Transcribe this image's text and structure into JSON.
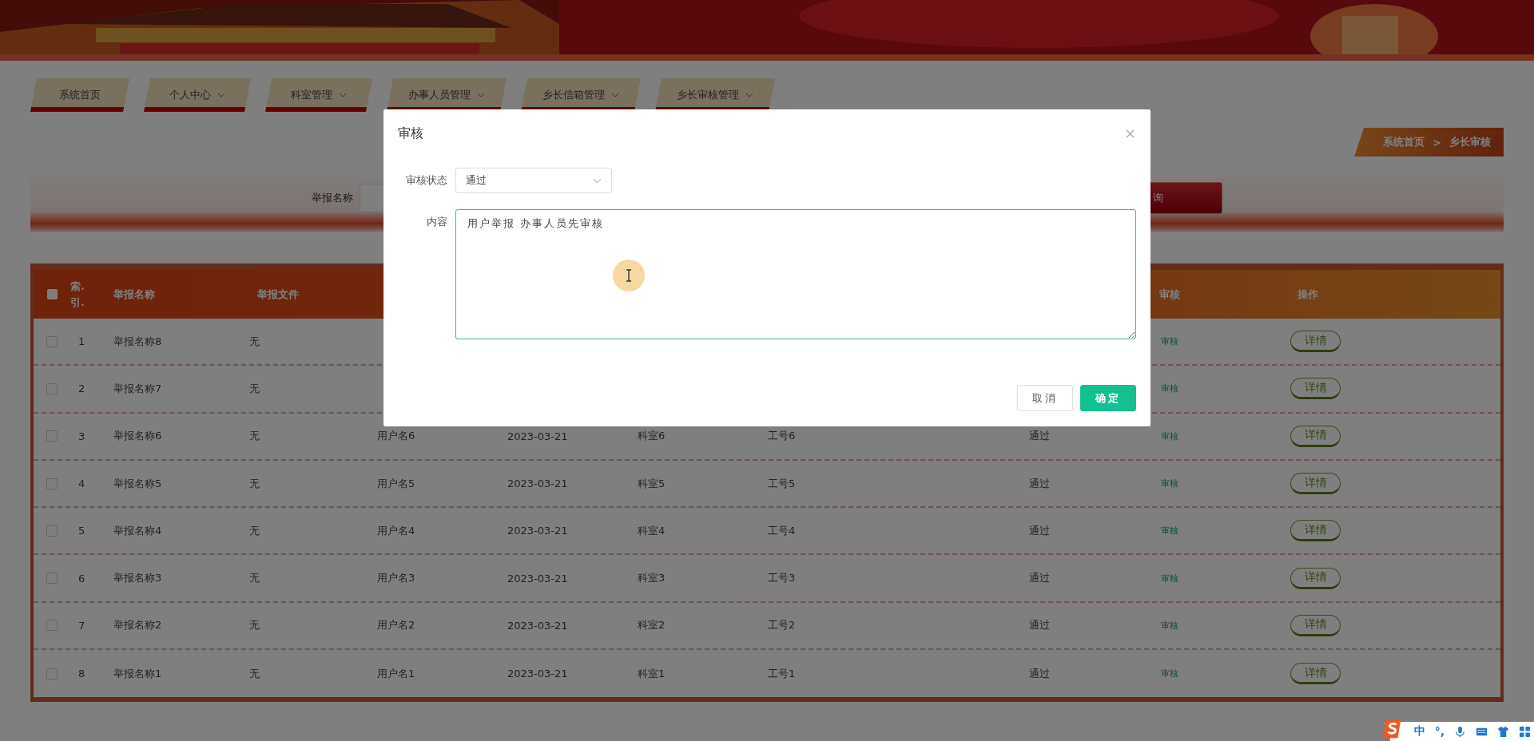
{
  "nav": [
    {
      "label": "系统首页",
      "has_menu": false
    },
    {
      "label": "个人中心",
      "has_menu": true
    },
    {
      "label": "科室管理",
      "has_menu": true
    },
    {
      "label": "办事人员管理",
      "has_menu": true
    },
    {
      "label": "乡长信箱管理",
      "has_menu": true
    },
    {
      "label": "乡长审核管理",
      "has_menu": true
    }
  ],
  "breadcrumb": [
    "系统首页",
    ">",
    "乡长审核"
  ],
  "search": {
    "label": "举报名称",
    "button": "询"
  },
  "table": {
    "select_all": {
      "checked": false
    },
    "columns": [
      {
        "label": "索.引."
      },
      {
        "label": "举报名称"
      },
      {
        "label": "举报文件"
      },
      {
        "label": "审核"
      },
      {
        "label": "操作"
      }
    ],
    "rows": [
      {
        "checked": false,
        "index": "1",
        "name": "举报名称8",
        "file": "无",
        "audit": "审核",
        "op": "详情"
      },
      {
        "checked": false,
        "index": "2",
        "name": "举报名称7",
        "file": "无",
        "audit": "审核",
        "op": "详情"
      },
      {
        "checked": false,
        "index": "3",
        "name": "举报名称6",
        "file": "无",
        "user": "用户名6",
        "date": "2023-03-21",
        "dept": "科室6",
        "staff": "工号6",
        "status": "通过",
        "audit": "审核",
        "op": "详情"
      },
      {
        "checked": false,
        "index": "4",
        "name": "举报名称5",
        "file": "无",
        "user": "用户名5",
        "date": "2023-03-21",
        "dept": "科室5",
        "staff": "工号5",
        "status": "通过",
        "audit": "审核",
        "op": "详情"
      },
      {
        "checked": false,
        "index": "5",
        "name": "举报名称4",
        "file": "无",
        "user": "用户名4",
        "date": "2023-03-21",
        "dept": "科室4",
        "staff": "工号4",
        "status": "通过",
        "audit": "审核",
        "op": "详情"
      },
      {
        "checked": false,
        "index": "6",
        "name": "举报名称3",
        "file": "无",
        "user": "用户名3",
        "date": "2023-03-21",
        "dept": "科室3",
        "staff": "工号3",
        "status": "通过",
        "audit": "审核",
        "op": "详情"
      },
      {
        "checked": false,
        "index": "7",
        "name": "举报名称2",
        "file": "无",
        "user": "用户名2",
        "date": "2023-03-21",
        "dept": "科室2",
        "staff": "工号2",
        "status": "通过",
        "audit": "审核",
        "op": "详情"
      },
      {
        "checked": false,
        "index": "8",
        "name": "举报名称1",
        "file": "无",
        "user": "用户名1",
        "date": "2023-03-21",
        "dept": "科室1",
        "staff": "工号1",
        "status": "通过",
        "audit": "审核",
        "op": "详情"
      }
    ]
  },
  "modal": {
    "title": "审核",
    "fields": [
      {
        "kind": "select",
        "label": "审核状态",
        "value": "通过"
      },
      {
        "kind": "textarea",
        "label": "内容",
        "value": "用户举报 办事人员先审核"
      }
    ],
    "buttons": [
      {
        "kind": "default",
        "label": "取消"
      },
      {
        "kind": "primary",
        "label": "确定"
      }
    ]
  },
  "ime": {
    "items": [
      {
        "kind": "logo"
      },
      {
        "kind": "text",
        "text": "中"
      },
      {
        "kind": "text",
        "text": "°,"
      },
      {
        "kind": "mic"
      },
      {
        "kind": "keyboard"
      },
      {
        "kind": "shirt"
      },
      {
        "kind": "grid"
      }
    ]
  }
}
